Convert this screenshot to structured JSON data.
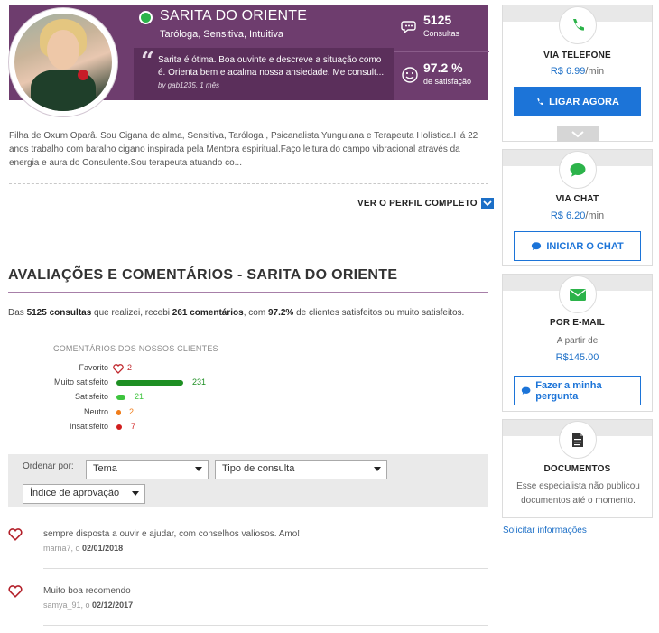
{
  "profile": {
    "name": "SARITA DO ORIENTE",
    "specialties": "Taróloga, Sensitiva, Intuitiva",
    "status": "online",
    "quote": "Sarita é ótima. Boa ouvinte e descreve a situação como é. Orienta bem e acalma nossa ansiedade. Me consult...",
    "quote_by": "by gab1235, 1 mês",
    "consultas_value": "5125",
    "consultas_label": "Consultas",
    "satisfacao_value": "97.2 %",
    "satisfacao_label": "de satisfação",
    "bio": "Filha de Oxum Oparâ. Sou Cigana de alma, Sensitiva, Taróloga , Psicanalista Yunguiana e Terapeuta Holística.Há 22 anos trabalho com baralho cigano inspirada pela Mentora espiritual.Faço leitura do campo vibracional através da energia e aura do Consulente.Sou terapeuta atuando co...",
    "full_profile_link": "VER O PERFIL COMPLETO"
  },
  "reviews": {
    "title": "AVALIAÇÕES E COMENTÁRIOS - SARITA DO ORIENTE",
    "summary_parts": {
      "a": "Das ",
      "b": "5125 consultas",
      "c": " que realizei, recebi ",
      "d": "261 comentários",
      "e": ", com ",
      "f": "97.2%",
      "g": " de clientes satisfeitos ou muito satisfeitos."
    },
    "breakdown_title": "COMENTÁRIOS DOS NOSSOS CLIENTES",
    "breakdown": [
      {
        "label": "Favorito",
        "value": "2",
        "color": "#c0282d",
        "kind": "heart"
      },
      {
        "label": "Muito satisfeito",
        "value": "231",
        "color": "#1e8f23",
        "kind": "bar"
      },
      {
        "label": "Satisfeito",
        "value": "21",
        "color": "#3ec43e",
        "kind": "bar"
      },
      {
        "label": "Neutro",
        "value": "2",
        "color": "#f07d1a",
        "kind": "bar"
      },
      {
        "label": "Insatisfeito",
        "value": "7",
        "color": "#d01e1e",
        "kind": "bar"
      }
    ],
    "filters": {
      "label": "Ordenar por:",
      "tema": "Tema",
      "tipo": "Tipo de consulta",
      "indice": "Índice de aprovação"
    },
    "comments": [
      {
        "text": "sempre disposta a ouvir e ajudar, com conselhos valiosos. Amo!",
        "user": "marna7, o",
        "date": "02/01/2018"
      },
      {
        "text": "Muito boa recomendo",
        "user": "samya_91, o",
        "date": "02/12/2017"
      }
    ]
  },
  "sidebar": {
    "phone": {
      "title": "VIA TELEFONE",
      "price": "R$ 6.99",
      "unit": "/min",
      "button": "LIGAR AGORA"
    },
    "chat": {
      "title": "VIA CHAT",
      "price": "R$ 6.20",
      "unit": "/min",
      "button": "INICIAR O CHAT"
    },
    "email": {
      "title": "POR E-MAIL",
      "sub": "A partir de",
      "price": "R$145.00",
      "button": "Fazer a minha pergunta"
    },
    "docs": {
      "title": "DOCUMENTOS",
      "text": "Esse especialista não publicou documentos até o momento."
    },
    "request_link": "Solicitar informações"
  },
  "colors": {
    "brand_purple": "#6e3d6e",
    "accent_blue": "#1c74d8",
    "green": "#2cb34a"
  }
}
